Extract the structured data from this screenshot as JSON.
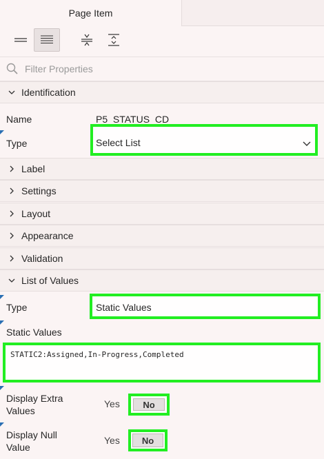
{
  "tabs": {
    "active": "Page Item"
  },
  "toolbar": {
    "buttons": [
      "collapse-rows-icon",
      "expand-rows-icon",
      "collapse-all-icon",
      "expand-all-icon"
    ]
  },
  "filter": {
    "placeholder": "Filter Properties",
    "value": ""
  },
  "sections": {
    "identification": "Identification",
    "label": "Label",
    "settings": "Settings",
    "layout": "Layout",
    "appearance": "Appearance",
    "validation": "Validation",
    "lov": "List of Values"
  },
  "identification": {
    "name_label": "Name",
    "name_value": "P5_STATUS_CD",
    "type_label": "Type",
    "type_value": "Select List"
  },
  "lov": {
    "type_label": "Type",
    "type_value": "Static Values",
    "static_label": "Static Values",
    "static_value": "STATIC2:Assigned,In-Progress,Completed",
    "extra_label_1": "Display Extra",
    "extra_label_2": "Values",
    "extra_yes": "Yes",
    "extra_no": "No",
    "null_label_1": "Display Null",
    "null_label_2": "Value",
    "null_yes": "Yes",
    "null_no": "No"
  },
  "colors": {
    "highlight": "#22ee22",
    "modified_marker": "#2a6fb3",
    "background": "#fbf4f4"
  }
}
